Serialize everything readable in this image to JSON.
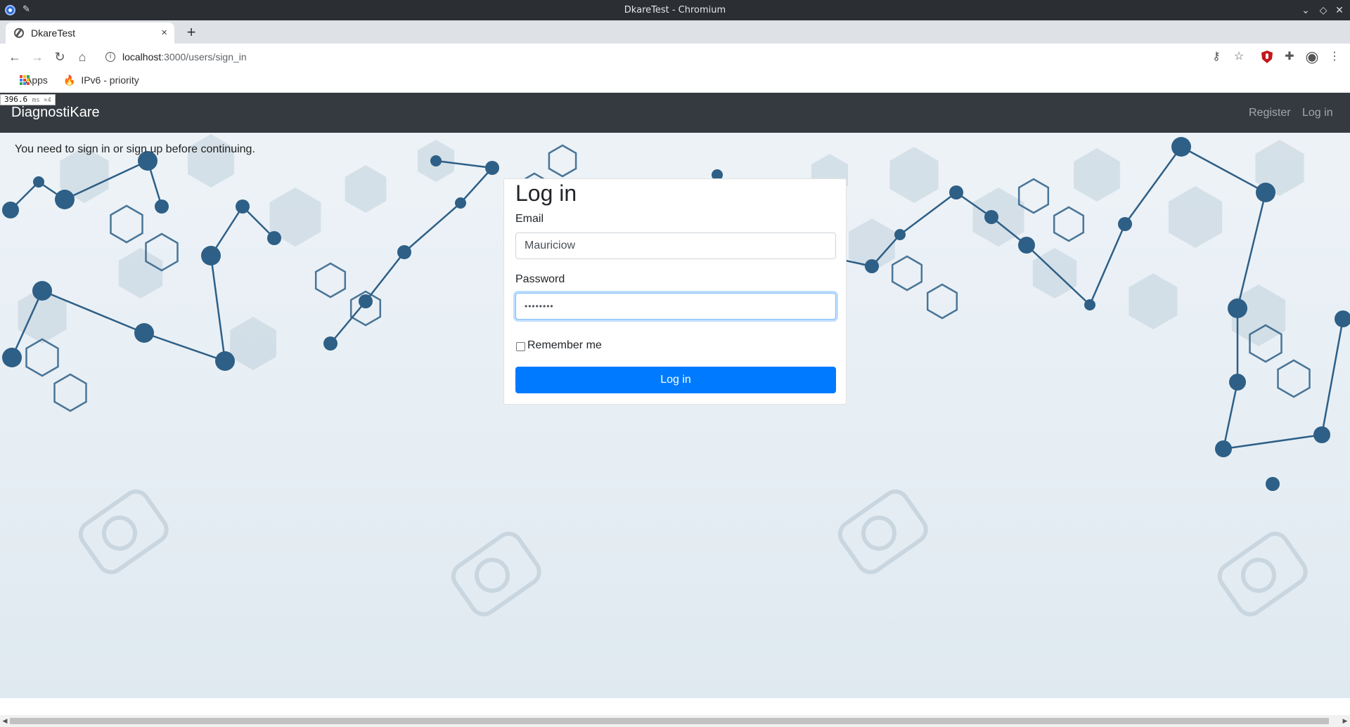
{
  "window": {
    "title": "DkareTest - Chromium",
    "controls": [
      "⌄",
      "◇",
      "✕"
    ]
  },
  "tab": {
    "title": "DkareTest",
    "close": "×",
    "new_tab": "+"
  },
  "toolbar": {
    "back": "←",
    "forward": "→",
    "reload": "↻",
    "home": "⌂",
    "url_host": "localhost",
    "url_path": ":3000/users/sign_in",
    "info": "i",
    "key": "⚷",
    "star": "☆",
    "extensions": "✚",
    "profile": "◉",
    "menu": "⋮"
  },
  "bookmarks": {
    "apps_label": "Apps",
    "item_label": "IPv6 - priority",
    "apps_colors": [
      "#ea4335",
      "#fbbc05",
      "#34a853",
      "#4285f4",
      "#ea4335",
      "#fbbc05",
      "#34a853",
      "#4285f4",
      "#ea4335"
    ]
  },
  "perf": {
    "value": "396.6",
    "unit": "ms ×4"
  },
  "navbar": {
    "brand": "DiagnostiKare",
    "register": "Register",
    "login": "Log in"
  },
  "flash": "You need to sign in or sign up before continuing.",
  "form": {
    "heading": "Log in",
    "email_label": "Email",
    "email_value": "Mauriciow",
    "password_label": "Password",
    "password_value": "••••••••",
    "remember_label": "Remember me",
    "submit_label": "Log in"
  },
  "colors": {
    "navbar": "#343a40",
    "primary": "#007bff",
    "molecule": "#2e5f86",
    "hexagon": "#b7c9d8"
  }
}
